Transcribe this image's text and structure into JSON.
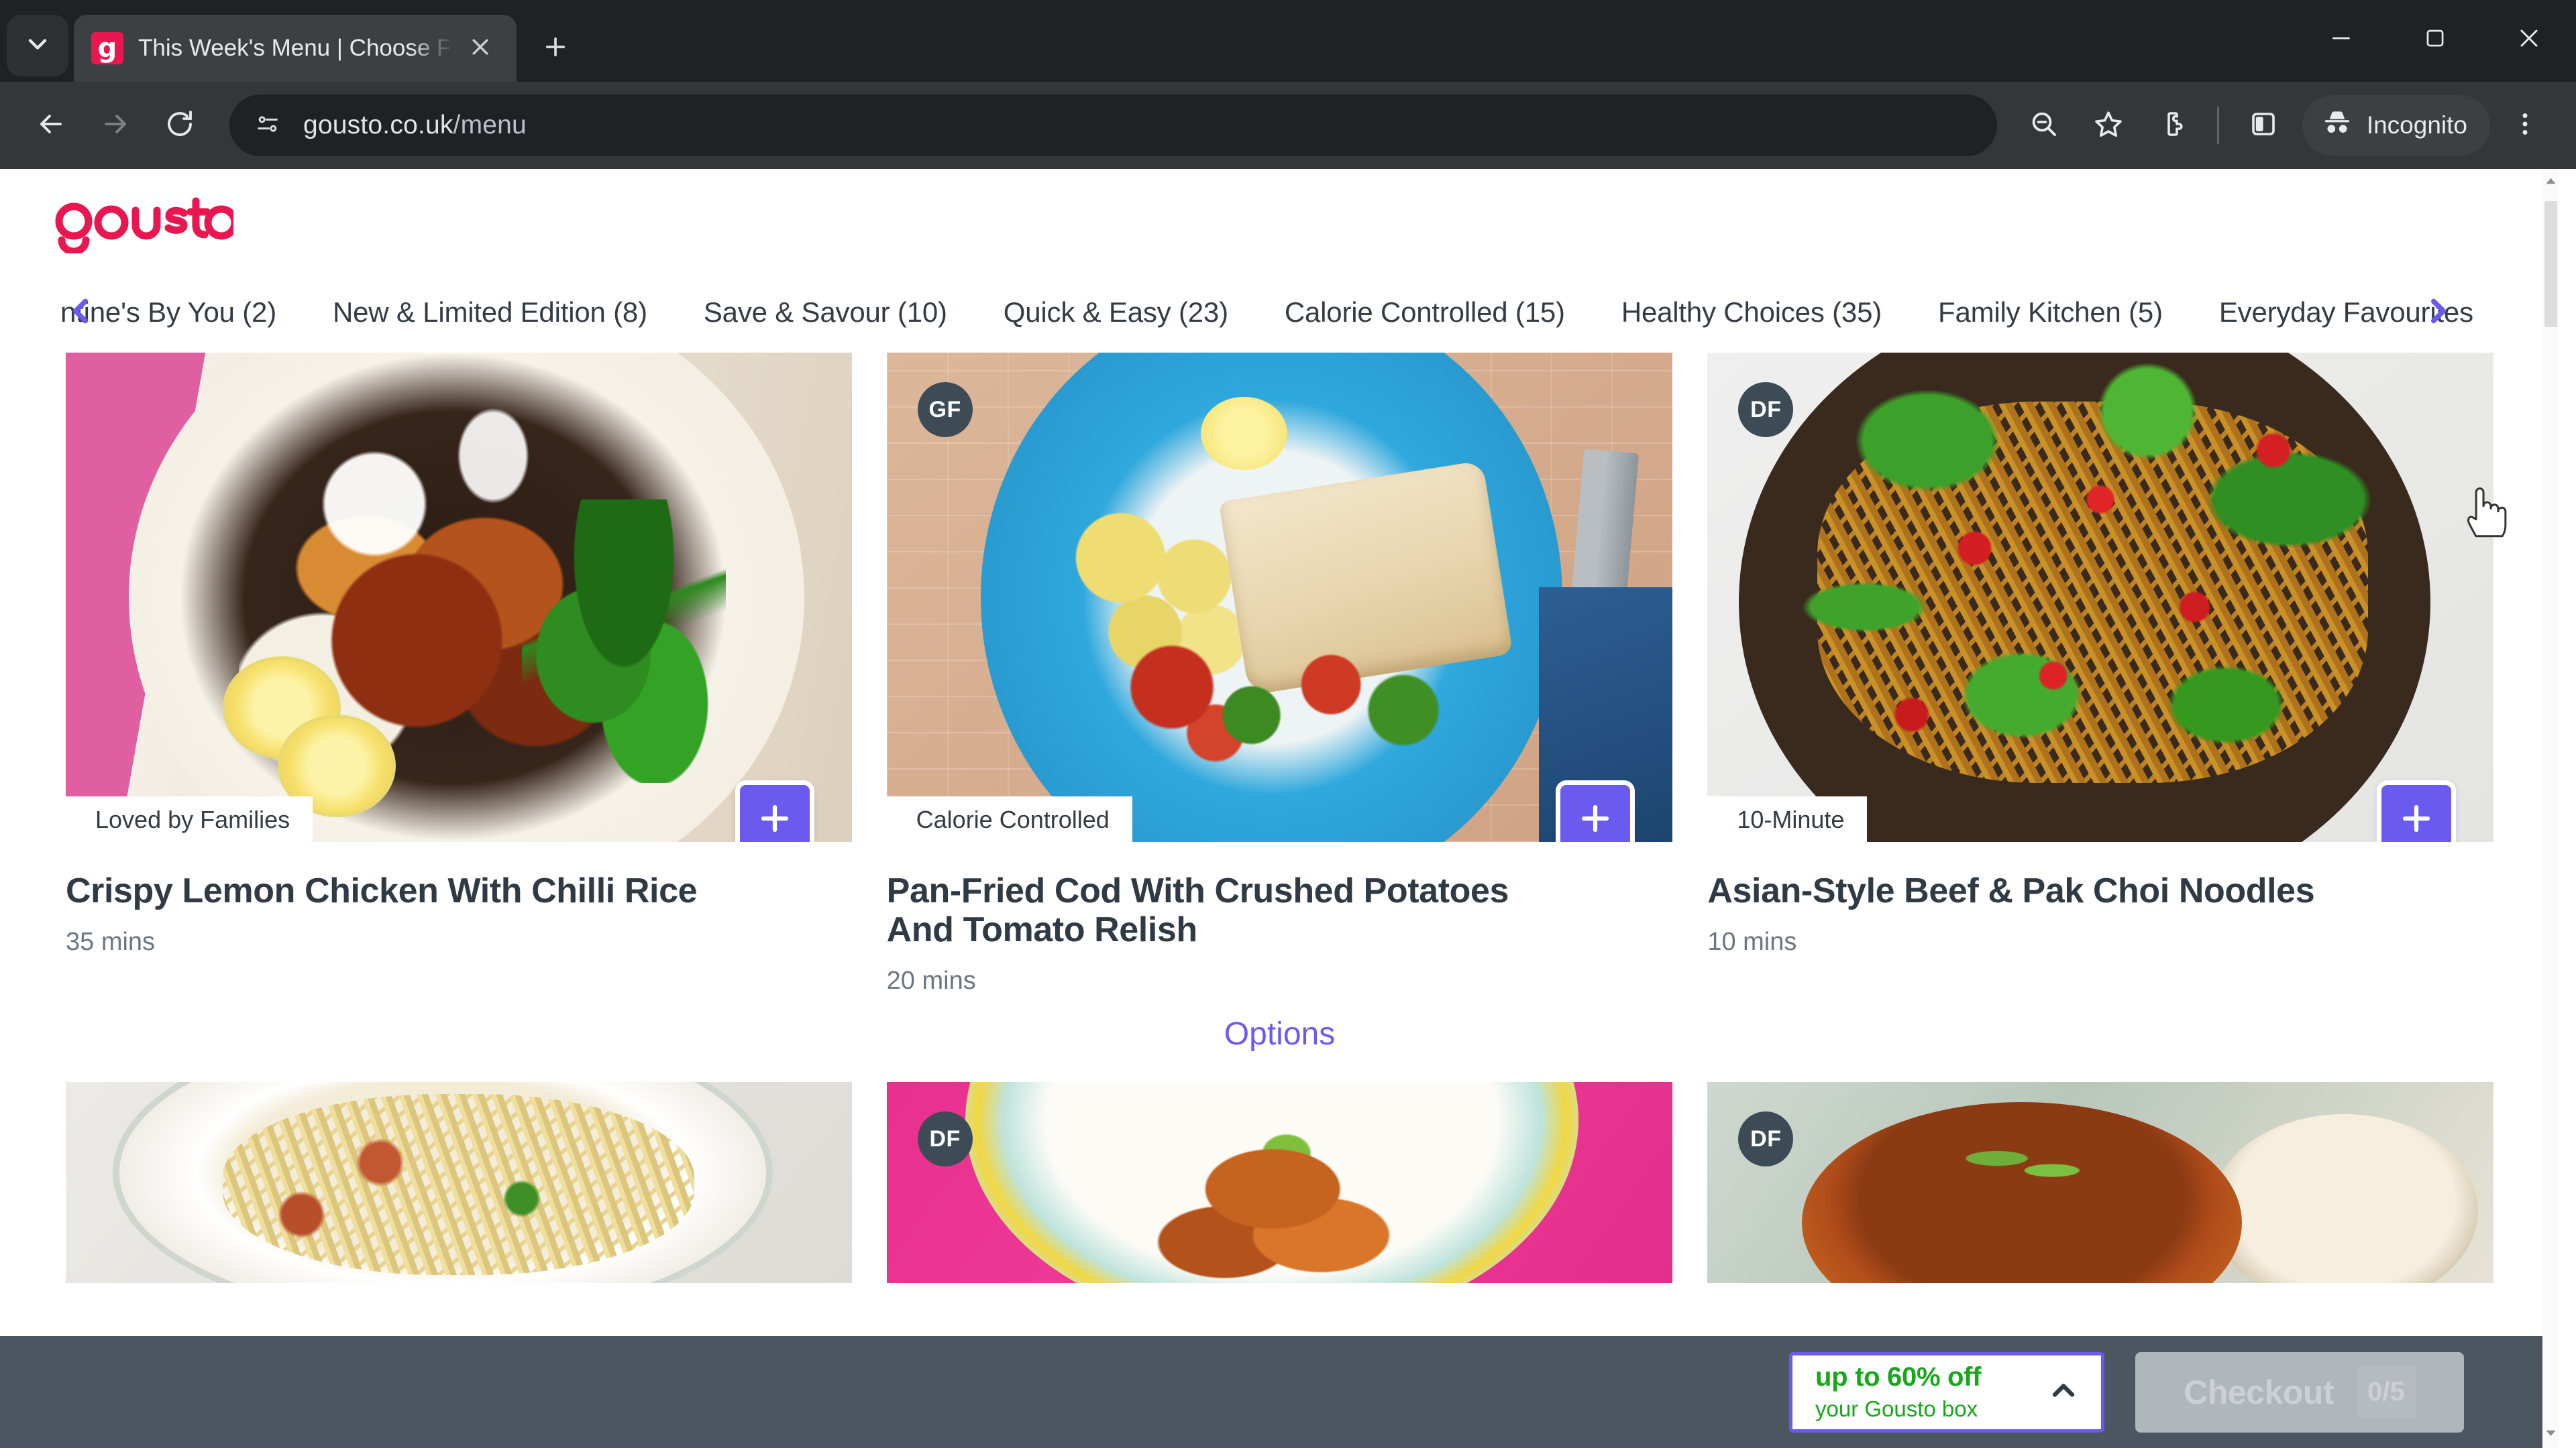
{
  "browser": {
    "tab_list_icon": "chevron-down-icon",
    "tab": {
      "favicon_letter": "g",
      "favicon_color": "#E8174F",
      "title": "This Week's Menu | Choose Fro",
      "close_icon": "close-icon"
    },
    "new_tab_icon": "plus-icon",
    "window_controls": {
      "minimize": "minimize-icon",
      "maximize": "maximize-icon",
      "close": "close-icon"
    },
    "toolbar": {
      "back_icon": "arrow-left-icon",
      "forward_icon": "arrow-right-icon",
      "reload_icon": "reload-icon",
      "site_info_icon": "page-settings-icon",
      "url_host": "gousto.co.uk",
      "url_path": "/menu",
      "zoom_icon": "zoom-out-icon",
      "bookmark_icon": "star-icon",
      "extensions_icon": "extensions-puzzle-icon",
      "side_panel_icon": "side-panel-icon",
      "incognito_icon": "incognito-hat-icon",
      "incognito_label": "Incognito",
      "menu_icon": "three-dot-menu-icon"
    }
  },
  "site": {
    "logo_text": "gousto",
    "logo_color": "#E8174F",
    "accent_purple": "#6A5AF0",
    "categories": [
      {
        "label": "ntine's By You",
        "count": "(2)"
      },
      {
        "label": "New & Limited Edition",
        "count": "(8)"
      },
      {
        "label": "Save & Savour",
        "count": "(10)"
      },
      {
        "label": "Quick & Easy",
        "count": "(23)"
      },
      {
        "label": "Calorie Controlled",
        "count": "(15)"
      },
      {
        "label": "Healthy Choices",
        "count": "(35)"
      },
      {
        "label": "Family Kitchen",
        "count": "(5)"
      },
      {
        "label": "Everyday Favourites",
        "count": ""
      }
    ],
    "nav_prev_icon": "chevron-left-icon",
    "nav_next_icon": "chevron-right-icon",
    "options_label": "Options",
    "recipes_row1": [
      {
        "diet_badge": "",
        "ribbon": "Loved by Families",
        "title": "Crispy Lemon Chicken With Chilli Rice",
        "time": "35 mins",
        "add_icon": "plus-icon"
      },
      {
        "diet_badge": "GF",
        "ribbon": "Calorie Controlled",
        "title": "Pan-Fried Cod With Crushed Potatoes And Tomato Relish",
        "time": "20 mins",
        "add_icon": "plus-icon"
      },
      {
        "diet_badge": "DF",
        "ribbon": "10-Minute",
        "title": "Asian-Style Beef & Pak Choi Noodles",
        "time": "10 mins",
        "add_icon": "plus-icon"
      }
    ],
    "recipes_row2": [
      {
        "diet_badge": ""
      },
      {
        "diet_badge": "DF"
      },
      {
        "diet_badge": "DF"
      }
    ]
  },
  "bottom_bar": {
    "promo_line1": "up to 60% off",
    "promo_line2": "your Gousto box",
    "promo_chevron_icon": "chevron-up-icon",
    "promo_text_color": "#17A81A",
    "checkout_label": "Checkout",
    "checkout_count": "0/5"
  },
  "scrollbar": {
    "up_icon": "triangle-up-icon",
    "down_icon": "triangle-down-icon"
  }
}
